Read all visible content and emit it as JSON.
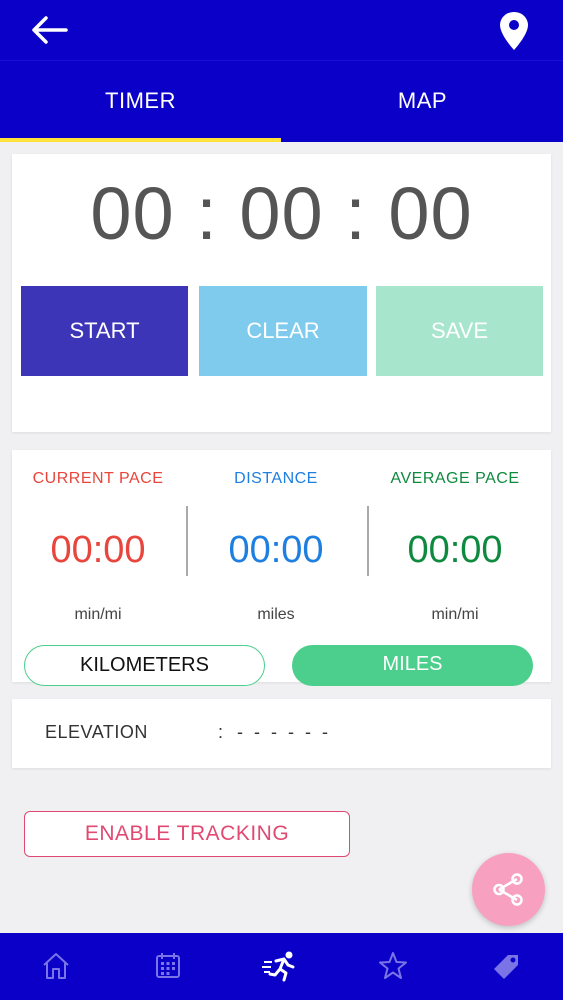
{
  "header": {
    "back_icon": "arrow-left-icon",
    "location_icon": "map-pin-icon"
  },
  "tabs": [
    {
      "label": "TIMER",
      "active": true
    },
    {
      "label": "MAP",
      "active": false
    }
  ],
  "timer": {
    "display": "00 : 00 : 00",
    "buttons": {
      "start": "START",
      "clear": "CLEAR",
      "save": "SAVE"
    }
  },
  "stats": {
    "current_pace": {
      "label": "CURRENT PACE",
      "value": "00:00",
      "unit": "min/mi",
      "color": "#e8453c"
    },
    "distance": {
      "label": "DISTANCE",
      "value": "00:00",
      "unit": "miles",
      "color": "#1e7fe0"
    },
    "average_pace": {
      "label": "AVERAGE PACE",
      "value": "00:00",
      "unit": "min/mi",
      "color": "#0e8a3e"
    }
  },
  "units_toggle": {
    "kilometers": "KILOMETERS",
    "miles": "MILES",
    "selected": "MILES"
  },
  "elevation": {
    "label": "ELEVATION",
    "separator": ":",
    "value": "- - - - - -"
  },
  "tracking": {
    "button_label": "ENABLE TRACKING"
  },
  "fab": {
    "icon": "share-icon",
    "color": "#f7a0bf"
  },
  "bottom_nav": [
    {
      "icon": "home-icon",
      "active": false
    },
    {
      "icon": "calendar-icon",
      "active": false
    },
    {
      "icon": "running-icon",
      "active": true
    },
    {
      "icon": "star-icon",
      "active": false
    },
    {
      "icon": "tag-icon",
      "active": false
    }
  ],
  "colors": {
    "primary": "#0a00c8",
    "tab_indicator": "#ffe23a",
    "start": "#3d35b8",
    "clear": "#7ecbee",
    "save": "#a7e6cc",
    "toggle_green": "#4ccf8c",
    "tracking_red": "#e04a72"
  }
}
